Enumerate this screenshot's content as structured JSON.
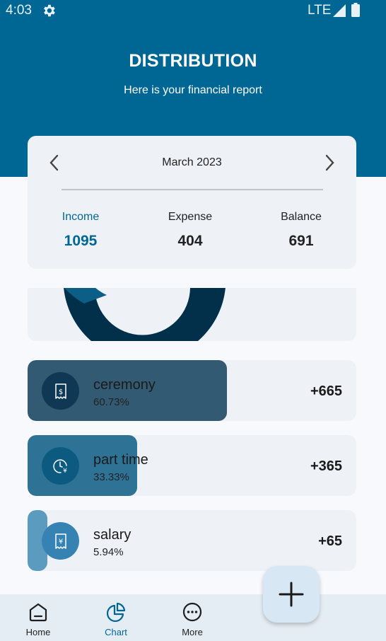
{
  "status_bar": {
    "time": "4:03",
    "network": "LTE",
    "icons": [
      "gear-icon",
      "signal-icon",
      "battery-icon"
    ]
  },
  "header": {
    "title": "DISTRIBUTION",
    "subtitle": "Here is your financial report"
  },
  "summary": {
    "month": "March 2023",
    "income_label": "Income",
    "income_value": "1095",
    "expense_label": "Expense",
    "expense_value": "404",
    "balance_label": "Balance",
    "balance_value": "691"
  },
  "categories": [
    {
      "name": "ceremony",
      "percent": "60.73%",
      "amount": "+665",
      "share": 0.6073,
      "fill_color": "#325a72",
      "icon_bg": "#0e3853",
      "icon": "receipt-dollar-icon"
    },
    {
      "name": "part time",
      "percent": "33.33%",
      "amount": "+365",
      "share": 0.3333,
      "fill_color": "#2e7395",
      "icon_bg": "#0d5a80",
      "icon": "clock-yen-icon"
    },
    {
      "name": "salary",
      "percent": "5.94%",
      "amount": "+65",
      "share": 0.0594,
      "fill_color": "#5b9bc0",
      "icon_bg": "#3683b3",
      "icon": "receipt-yen-icon"
    }
  ],
  "nav": {
    "home_label": "Home",
    "chart_label": "Chart",
    "more_label": "More"
  },
  "colors": {
    "primary": "#006795",
    "background": "#f8f9fd",
    "card": "#eef2f7",
    "donut_dark": "#022f4a",
    "fab": "#d8e7f4"
  }
}
